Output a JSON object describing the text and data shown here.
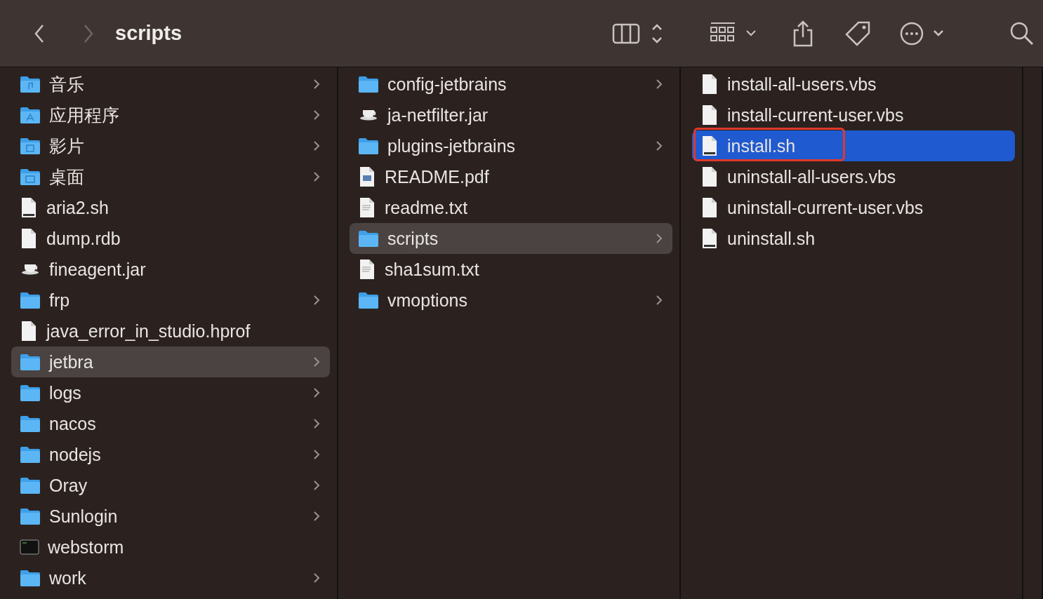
{
  "toolbar": {
    "title": "scripts",
    "back_disabled": false,
    "forward_disabled": true
  },
  "columns": [
    {
      "focused": false,
      "items": [
        {
          "name": "音乐",
          "kind": "music-folder",
          "folder": true,
          "selected": false,
          "outlined": false
        },
        {
          "name": "应用程序",
          "kind": "apps-folder",
          "folder": true,
          "selected": false,
          "outlined": false
        },
        {
          "name": "影片",
          "kind": "movies-folder",
          "folder": true,
          "selected": false,
          "outlined": false
        },
        {
          "name": "桌面",
          "kind": "desktop-folder",
          "folder": true,
          "selected": false,
          "outlined": false
        },
        {
          "name": "aria2.sh",
          "kind": "shell",
          "folder": false,
          "selected": false,
          "outlined": false
        },
        {
          "name": "dump.rdb",
          "kind": "doc",
          "folder": false,
          "selected": false,
          "outlined": false
        },
        {
          "name": "fineagent.jar",
          "kind": "jar",
          "folder": false,
          "selected": false,
          "outlined": false
        },
        {
          "name": "frp",
          "kind": "folder",
          "folder": true,
          "selected": false,
          "outlined": false
        },
        {
          "name": "java_error_in_studio.hprof",
          "kind": "doc",
          "folder": false,
          "selected": false,
          "outlined": false
        },
        {
          "name": "jetbra",
          "kind": "folder",
          "folder": true,
          "selected": true,
          "outlined": false
        },
        {
          "name": "logs",
          "kind": "folder",
          "folder": true,
          "selected": false,
          "outlined": false
        },
        {
          "name": "nacos",
          "kind": "folder",
          "folder": true,
          "selected": false,
          "outlined": false
        },
        {
          "name": "nodejs",
          "kind": "folder",
          "folder": true,
          "selected": false,
          "outlined": false
        },
        {
          "name": "Oray",
          "kind": "folder",
          "folder": true,
          "selected": false,
          "outlined": false
        },
        {
          "name": "Sunlogin",
          "kind": "folder",
          "folder": true,
          "selected": false,
          "outlined": false
        },
        {
          "name": "webstorm",
          "kind": "terminal",
          "folder": false,
          "selected": false,
          "outlined": false
        },
        {
          "name": "work",
          "kind": "folder",
          "folder": true,
          "selected": false,
          "outlined": false
        }
      ]
    },
    {
      "focused": false,
      "items": [
        {
          "name": "config-jetbrains",
          "kind": "folder",
          "folder": true,
          "selected": false,
          "outlined": false
        },
        {
          "name": "ja-netfilter.jar",
          "kind": "jar",
          "folder": false,
          "selected": false,
          "outlined": false
        },
        {
          "name": "plugins-jetbrains",
          "kind": "folder",
          "folder": true,
          "selected": false,
          "outlined": false
        },
        {
          "name": "README.pdf",
          "kind": "pdf",
          "folder": false,
          "selected": false,
          "outlined": false
        },
        {
          "name": "readme.txt",
          "kind": "txt",
          "folder": false,
          "selected": false,
          "outlined": false
        },
        {
          "name": "scripts",
          "kind": "folder",
          "folder": true,
          "selected": true,
          "outlined": false
        },
        {
          "name": "sha1sum.txt",
          "kind": "txt",
          "folder": false,
          "selected": false,
          "outlined": false
        },
        {
          "name": "vmoptions",
          "kind": "folder",
          "folder": true,
          "selected": false,
          "outlined": false
        }
      ]
    },
    {
      "focused": true,
      "items": [
        {
          "name": "install-all-users.vbs",
          "kind": "doc",
          "folder": false,
          "selected": false,
          "outlined": false
        },
        {
          "name": "install-current-user.vbs",
          "kind": "doc",
          "folder": false,
          "selected": false,
          "outlined": false
        },
        {
          "name": "install.sh",
          "kind": "shell",
          "folder": false,
          "selected": true,
          "outlined": true
        },
        {
          "name": "uninstall-all-users.vbs",
          "kind": "doc",
          "folder": false,
          "selected": false,
          "outlined": false
        },
        {
          "name": "uninstall-current-user.vbs",
          "kind": "doc",
          "folder": false,
          "selected": false,
          "outlined": false
        },
        {
          "name": "uninstall.sh",
          "kind": "shell",
          "folder": false,
          "selected": false,
          "outlined": false
        }
      ]
    }
  ]
}
